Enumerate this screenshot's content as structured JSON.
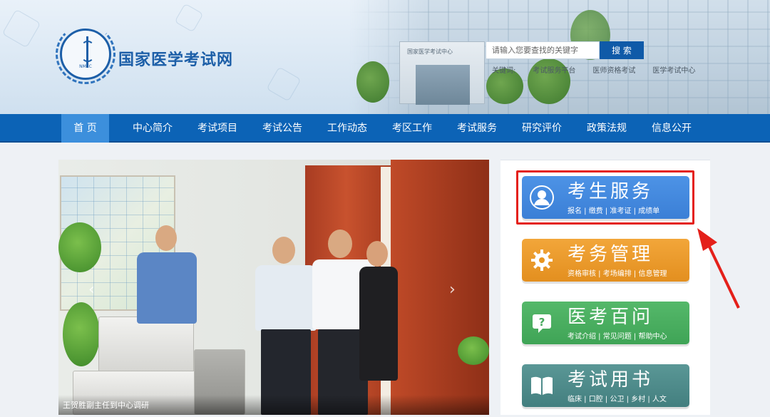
{
  "site": {
    "title": "国家医学考试网",
    "emblem_text": "NMEC"
  },
  "search": {
    "placeholder": "请输入您要查找的关键字",
    "button_label": "搜 索"
  },
  "quicklinks": [
    "关键词:",
    "考试服务平台",
    "医师资格考试",
    "医学考试中心"
  ],
  "building_sign": "国家医学考试中心",
  "nav": {
    "items": [
      "首 页",
      "中心简介",
      "考试项目",
      "考试公告",
      "工作动态",
      "考区工作",
      "考试服务",
      "研究评价",
      "政策法规",
      "信息公开"
    ],
    "active_index": 0
  },
  "carousel": {
    "caption": "王贺胜副主任到中心调研"
  },
  "services": [
    {
      "title": "考生服务",
      "sub": "报名 | 缴费 | 准考证 | 成绩单",
      "icon": "user-icon",
      "color": "#4189dd"
    },
    {
      "title": "考务管理",
      "sub": "资格审核 | 考场编排 | 信息管理",
      "icon": "gear-icon",
      "color": "#eb9a2c"
    },
    {
      "title": "医考百问",
      "sub": "考试介绍 | 常见问题 | 帮助中心",
      "icon": "question-icon",
      "color": "#4aae60"
    },
    {
      "title": "考试用书",
      "sub": "临床 | 口腔 | 公卫 | 乡村 | 人文",
      "icon": "book-icon",
      "color": "#4f8b8a"
    }
  ],
  "annotation_color": "#e4201a"
}
